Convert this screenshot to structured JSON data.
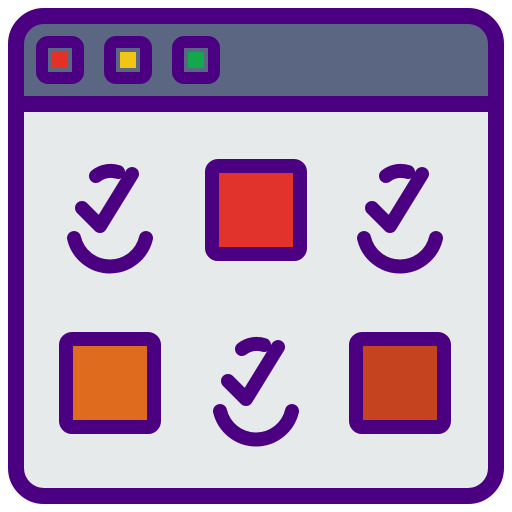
{
  "colors": {
    "outline": "#4b0082",
    "titlebar": "#5a6682",
    "window_body": "#e7eaea",
    "dot_red": "#e43027",
    "dot_yellow": "#f2c414",
    "dot_green": "#13a84e",
    "square_red": "#e1322c",
    "square_orange": "#df6b1e",
    "square_darkorange": "#c6431f"
  },
  "window": {
    "controls": [
      {
        "icon": "close-dot-icon",
        "color_key": "dot_red"
      },
      {
        "icon": "minimize-dot-icon",
        "color_key": "dot_yellow"
      },
      {
        "icon": "maximize-dot-icon",
        "color_key": "dot_green"
      }
    ]
  },
  "grid": {
    "rows": [
      [
        {
          "type": "check",
          "state": "checked"
        },
        {
          "type": "box",
          "state": "unchecked",
          "color_key": "square_red"
        },
        {
          "type": "check",
          "state": "checked"
        }
      ],
      [
        {
          "type": "box",
          "state": "unchecked",
          "color_key": "square_orange"
        },
        {
          "type": "check",
          "state": "checked"
        },
        {
          "type": "box",
          "state": "unchecked",
          "color_key": "square_darkorange"
        }
      ]
    ]
  }
}
